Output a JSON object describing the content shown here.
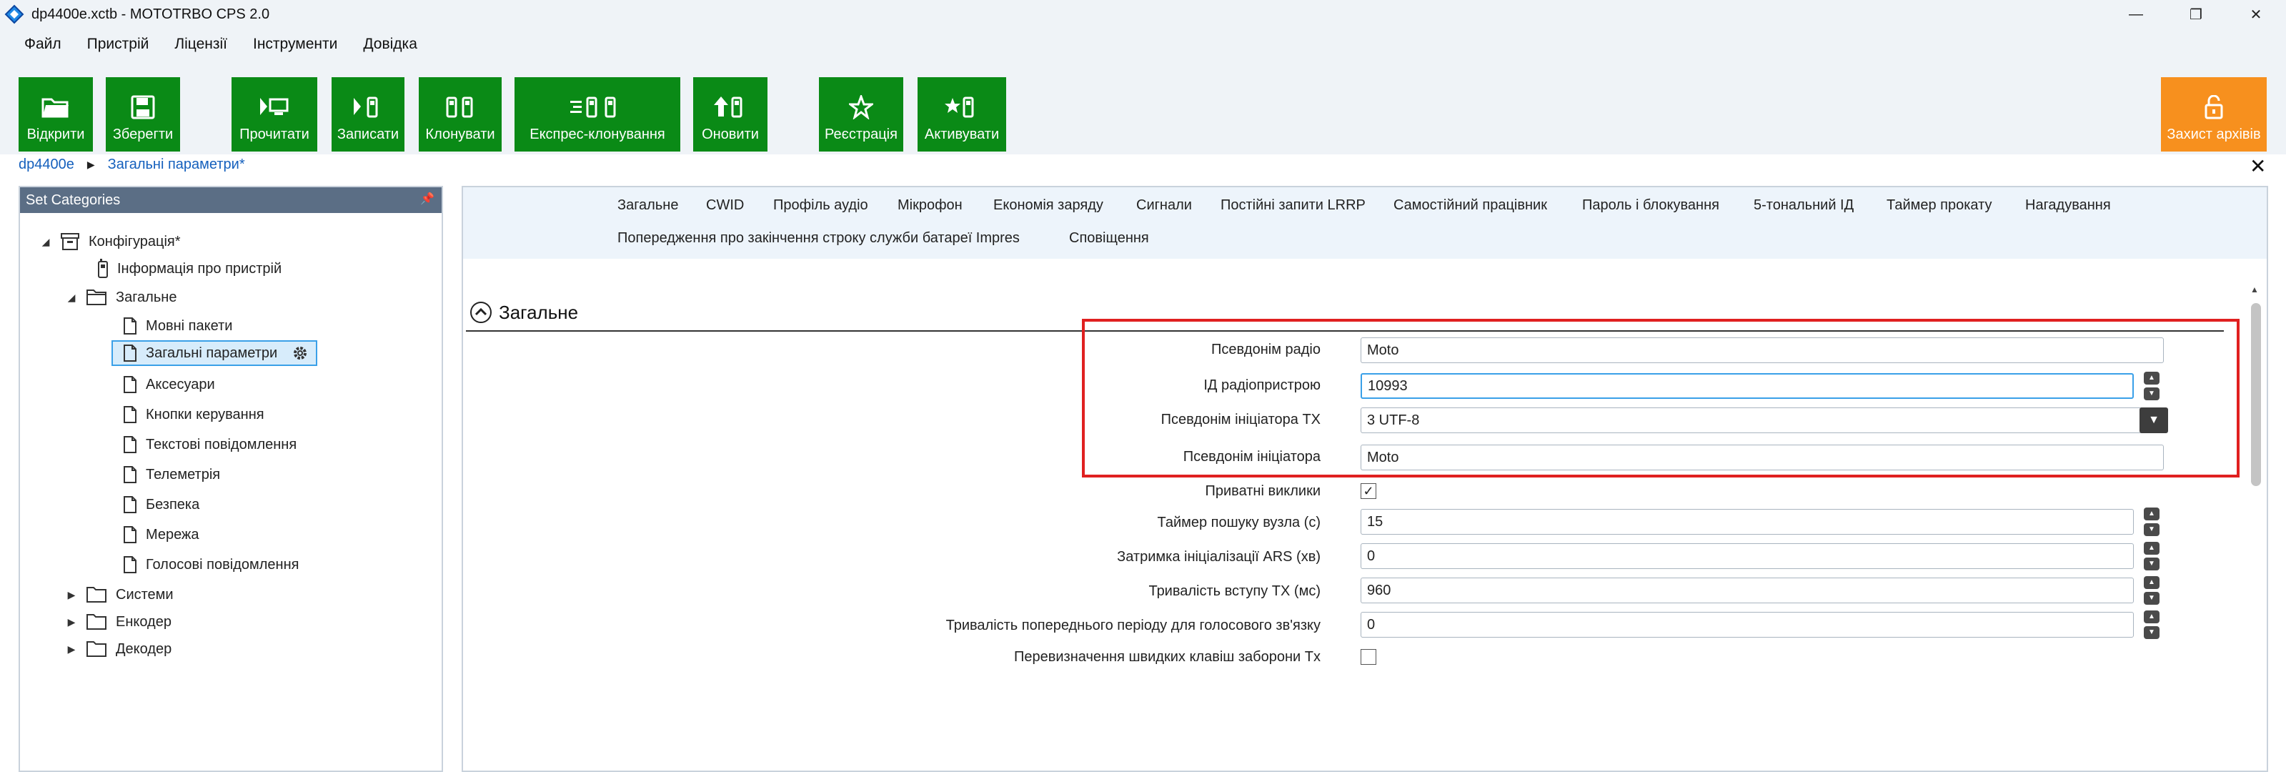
{
  "window": {
    "title": "dp4400e.xctb - MOTOTRBO CPS 2.0",
    "controls": [
      "—",
      "❐",
      "✕"
    ]
  },
  "menu": [
    "Файл",
    "Пристрій",
    "Ліцензії",
    "Інструменти",
    "Довідка"
  ],
  "ribbon": {
    "open": "Відкрити",
    "save": "Зберегти",
    "read": "Прочитати",
    "write": "Записати",
    "clone": "Клонувати",
    "express_clone": "Експрес-клонування",
    "update": "Оновити",
    "register": "Реєстрація",
    "activate": "Активувати",
    "archive_protect": "Захист архівів"
  },
  "breadcrumb": {
    "root": "dp4400e",
    "current": "Загальні параметри*"
  },
  "left_panel": {
    "header": "Set Categories",
    "tree": {
      "configuration": "Конфігурація*",
      "device_info": "Інформація про пристрій",
      "general": "Загальне",
      "language_packs": "Мовні пакети",
      "general_settings": "Загальні параметри",
      "accessories": "Аксесуари",
      "control_buttons": "Кнопки керування",
      "text_messages": "Текстові повідомлення",
      "telemetry": "Телеметрія",
      "security": "Безпека",
      "network": "Мережа",
      "voice_messages": "Голосові повідомлення",
      "systems": "Системи",
      "encoder": "Енкодер",
      "decoder": "Декодер"
    }
  },
  "tabs": {
    "row1": [
      "Загальне",
      "CWID",
      "Профіль аудіо",
      "Мікрофон",
      "Економія заряду",
      "Сигнали",
      "Постійні запити LRRP",
      "Самостійний працівник",
      "Пароль і блокування",
      "5-тональний ІД",
      "Таймер прокату",
      "Нагадування"
    ],
    "row2": [
      "Попередження про закінчення строку служби батареї Impres",
      "Сповіщення"
    ]
  },
  "section": {
    "title": "Загальне"
  },
  "fields": {
    "radio_alias": {
      "label": "Псевдонім радіо",
      "value": "Moto"
    },
    "radio_id": {
      "label": "ІД радіопристрою",
      "value": "10993"
    },
    "tx_alias": {
      "label": "Псевдонім ініціатора ТХ",
      "value": "3 UTF-8"
    },
    "initiator_alias": {
      "label": "Псевдонім ініціатора",
      "value": "Moto"
    },
    "private_calls": {
      "label": "Приватні виклики",
      "checked": true
    },
    "node_search_timer": {
      "label": "Таймер пошуку вузла (с)",
      "value": "15"
    },
    "ars_delay": {
      "label": "Затримка ініціалізації ARS (хв)",
      "value": "0"
    },
    "tx_preamble": {
      "label": "Тривалість вступу ТХ (мс)",
      "value": "960"
    },
    "voice_pre_period": {
      "label": "Тривалість попереднього періоду для голосового зв'язку",
      "value": "0"
    },
    "quick_key_override": {
      "label": "Перевизначення швидких клавіш заборони Tx",
      "checked": false
    }
  },
  "colors": {
    "ribbon_green": "#0a8a16",
    "ribbon_orange": "#f7901e",
    "highlight_red": "#e02020",
    "panel_header": "#5b6e85"
  }
}
